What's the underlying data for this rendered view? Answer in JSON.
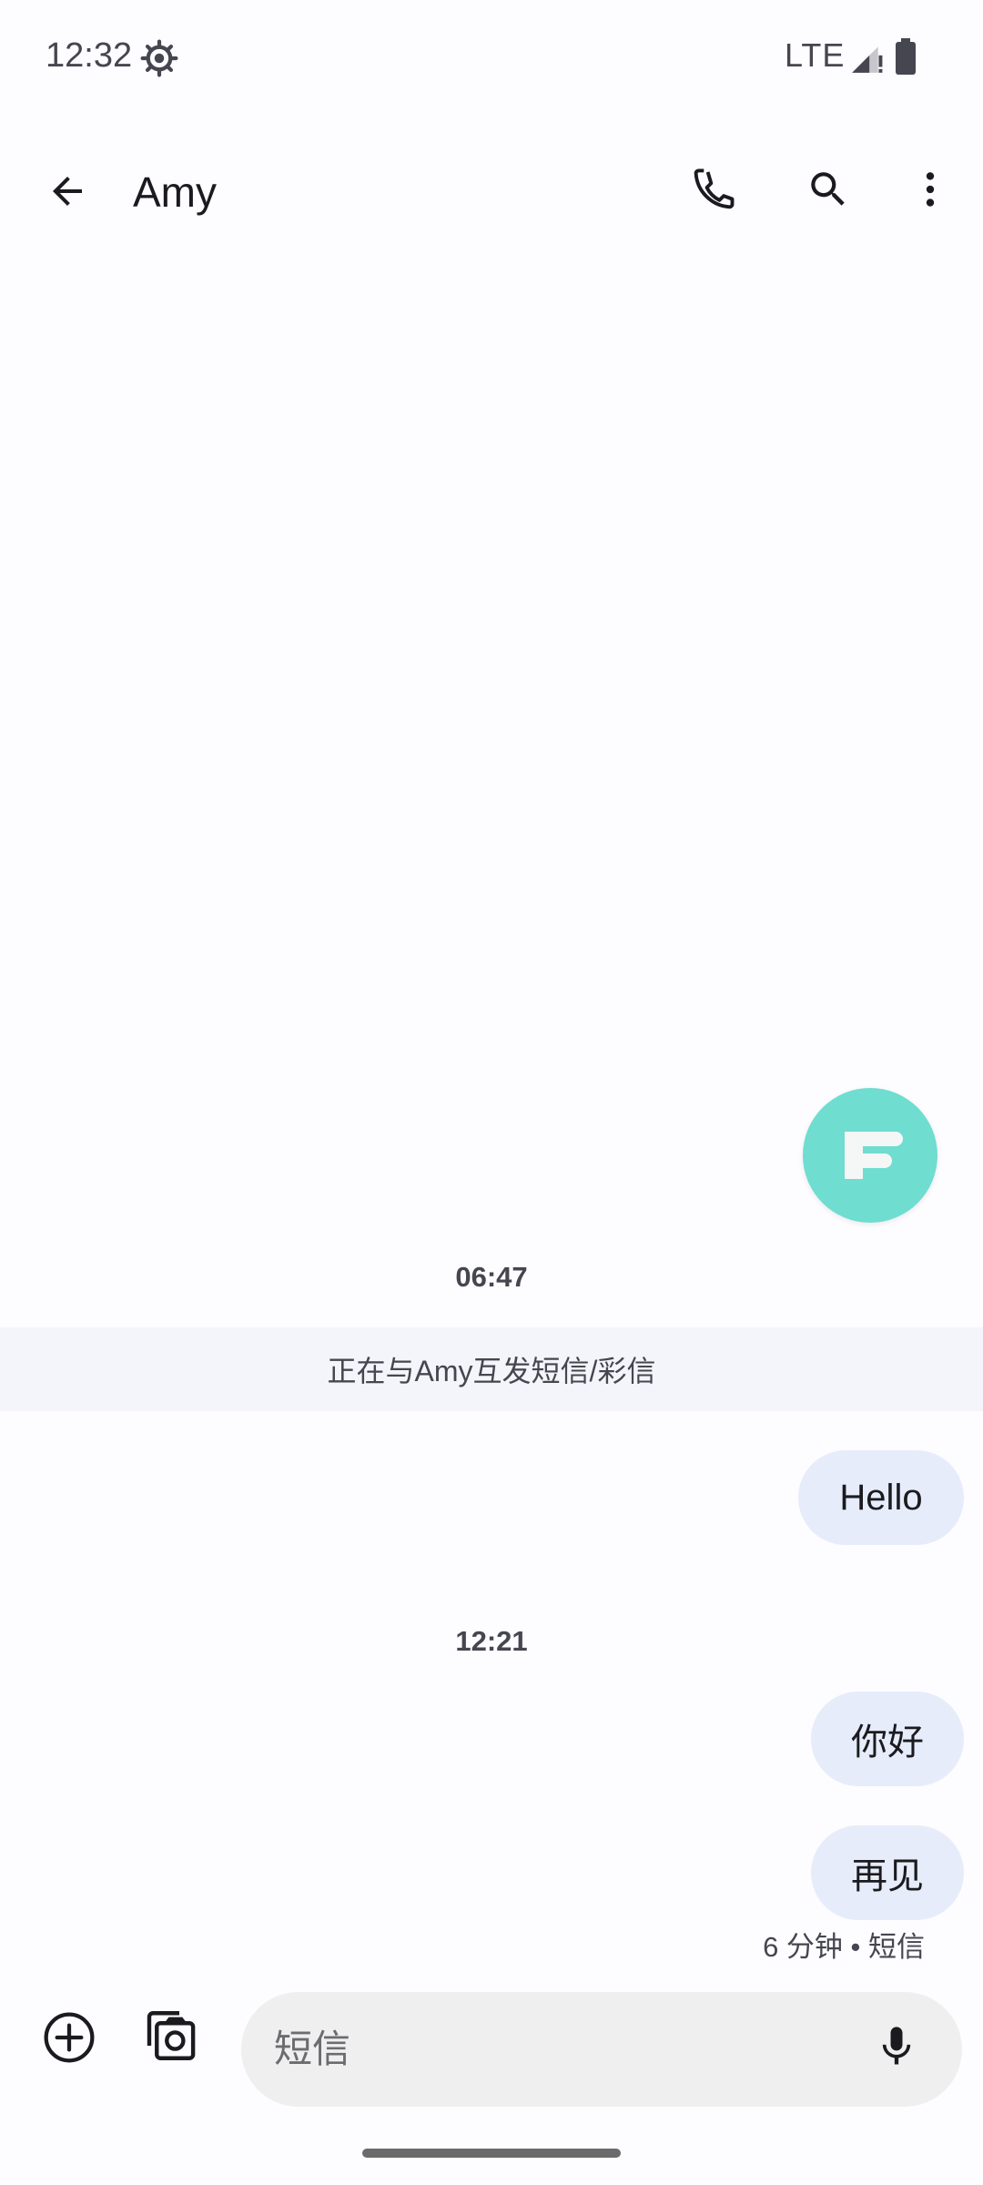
{
  "status_bar": {
    "time": "12:32",
    "network": "LTE",
    "icons": [
      "settings-icon",
      "signal-icon",
      "battery-icon"
    ]
  },
  "app_bar": {
    "contact_name": "Amy",
    "icons": [
      "back-arrow-icon",
      "phone-icon",
      "search-icon",
      "more-vert-icon"
    ]
  },
  "fab": {
    "icon": "app-logo-icon",
    "color": "#6fddd0"
  },
  "conversation": {
    "timestamp_1": "06:47",
    "banner": "正在与Amy互发短信/彩信",
    "messages": [
      {
        "text": "Hello"
      },
      {
        "text": "你好"
      },
      {
        "text": "再见"
      }
    ],
    "timestamp_2": "12:21",
    "last_message_meta": "6 分钟 • 短信"
  },
  "compose": {
    "placeholder": "短信",
    "value": "",
    "icons": [
      "add-circle-icon",
      "gallery-camera-icon",
      "mic-icon"
    ]
  },
  "colors": {
    "bubble": "#e6ecfa",
    "banner": "#f3f5fb",
    "compose_field": "#efefef"
  }
}
